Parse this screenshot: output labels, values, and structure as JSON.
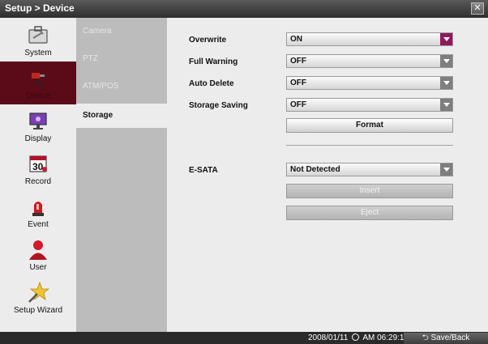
{
  "header": {
    "title": "Setup > Device",
    "close_label": "✕"
  },
  "sidebar": {
    "items": [
      {
        "label": "System",
        "icon": "toolbox-icon"
      },
      {
        "label": "Device",
        "icon": "cable-plug-icon",
        "active": true
      },
      {
        "label": "Display",
        "icon": "monitor-icon"
      },
      {
        "label": "Record",
        "icon": "calendar-icon"
      },
      {
        "label": "Event",
        "icon": "alarm-light-icon"
      },
      {
        "label": "User",
        "icon": "user-icon"
      },
      {
        "label": "Setup Wizard",
        "icon": "wand-star-icon"
      }
    ]
  },
  "subnav": {
    "items": [
      {
        "label": "Camera"
      },
      {
        "label": "PTZ"
      },
      {
        "label": "ATM/POS"
      },
      {
        "label": "Storage",
        "active": true
      }
    ]
  },
  "storage": {
    "overwrite": {
      "label": "Overwrite",
      "value": "ON"
    },
    "full_warning": {
      "label": "Full Warning",
      "value": "OFF"
    },
    "auto_delete": {
      "label": "Auto Delete",
      "value": "OFF"
    },
    "storage_saving": {
      "label": "Storage Saving",
      "value": "OFF"
    },
    "format_label": "Format",
    "esata": {
      "label": "E-SATA",
      "value": "Not Detected"
    },
    "insert_label": "Insert",
    "eject_label": "Eject"
  },
  "status": {
    "date": "2008/01/11",
    "time": "AM 06:29:18",
    "save_back_label": "Save/Back"
  },
  "colors": {
    "active_sidebar": "#5b0b18",
    "active_dropdown_arrow": "#8e1a5c"
  }
}
